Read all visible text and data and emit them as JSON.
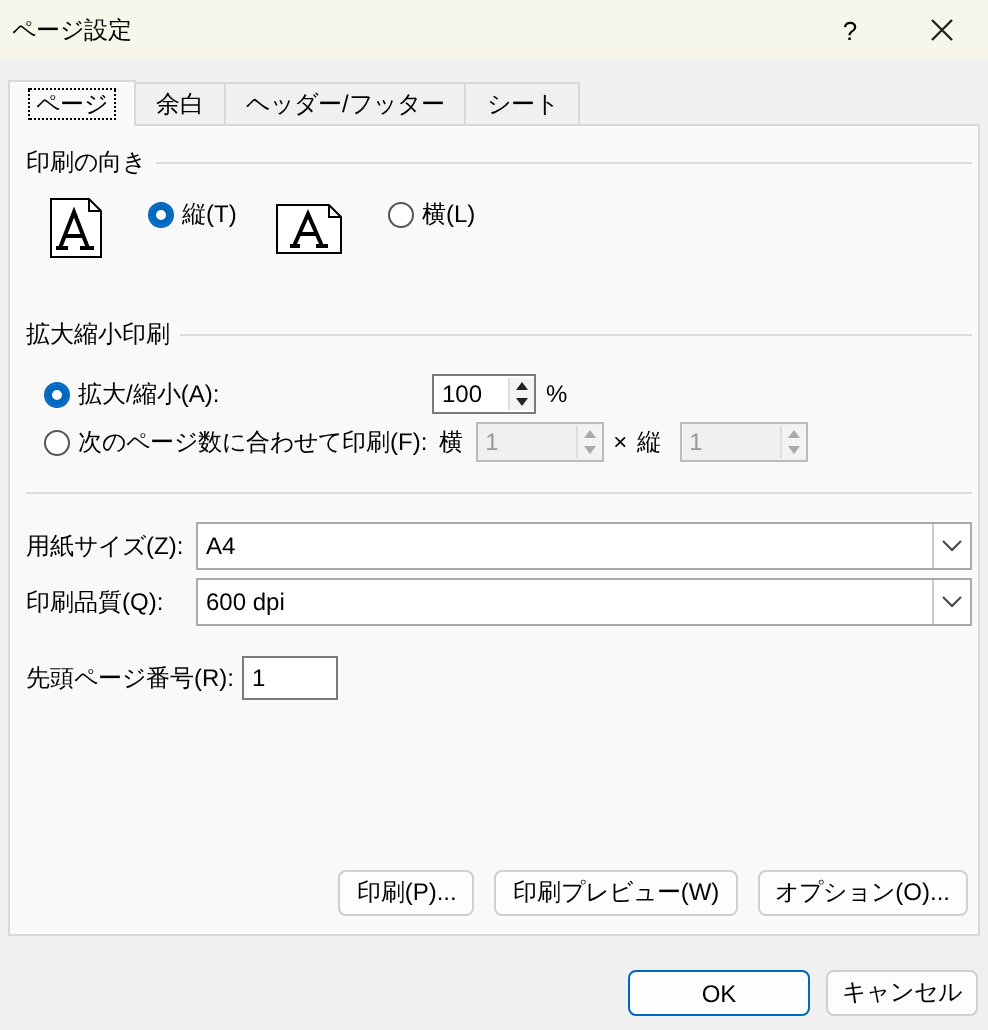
{
  "window": {
    "title": "ページ設定",
    "help": "?"
  },
  "tabs": [
    {
      "label": "ページ",
      "selected": true
    },
    {
      "label": "余白",
      "selected": false
    },
    {
      "label": "ヘッダー/フッター",
      "selected": false
    },
    {
      "label": "シート",
      "selected": false
    }
  ],
  "orientation": {
    "title": "印刷の向き",
    "options": [
      {
        "kind": "portrait",
        "label": "縦(T)",
        "selected": true
      },
      {
        "kind": "landscape",
        "label": "横(L)",
        "selected": false
      }
    ]
  },
  "scaling": {
    "title": "拡大縮小印刷",
    "options": [
      {
        "kind": "percent",
        "label": "拡大/縮小(A):",
        "selected": true,
        "value": "100",
        "unit": "%"
      },
      {
        "kind": "fit",
        "label": "次のページ数に合わせて印刷(F):",
        "selected": false,
        "wide_label": "横",
        "wide_value": "1",
        "times": "×",
        "tall_label": "縦",
        "tall_value": "1",
        "disabled": true
      }
    ]
  },
  "selects": [
    {
      "label": "用紙サイズ(Z):",
      "value": "A4"
    },
    {
      "label": "印刷品質(Q):",
      "value": "600 dpi"
    }
  ],
  "first_page": {
    "label": "先頭ページ番号(R):",
    "value": "1"
  },
  "buttons": [
    {
      "label": "印刷(P)..."
    },
    {
      "label": "印刷プレビュー(W)"
    },
    {
      "label": "オプション(O)..."
    }
  ],
  "footer_buttons": [
    {
      "label": "OK",
      "default": true
    },
    {
      "label": "キャンセル",
      "default": false
    }
  ]
}
